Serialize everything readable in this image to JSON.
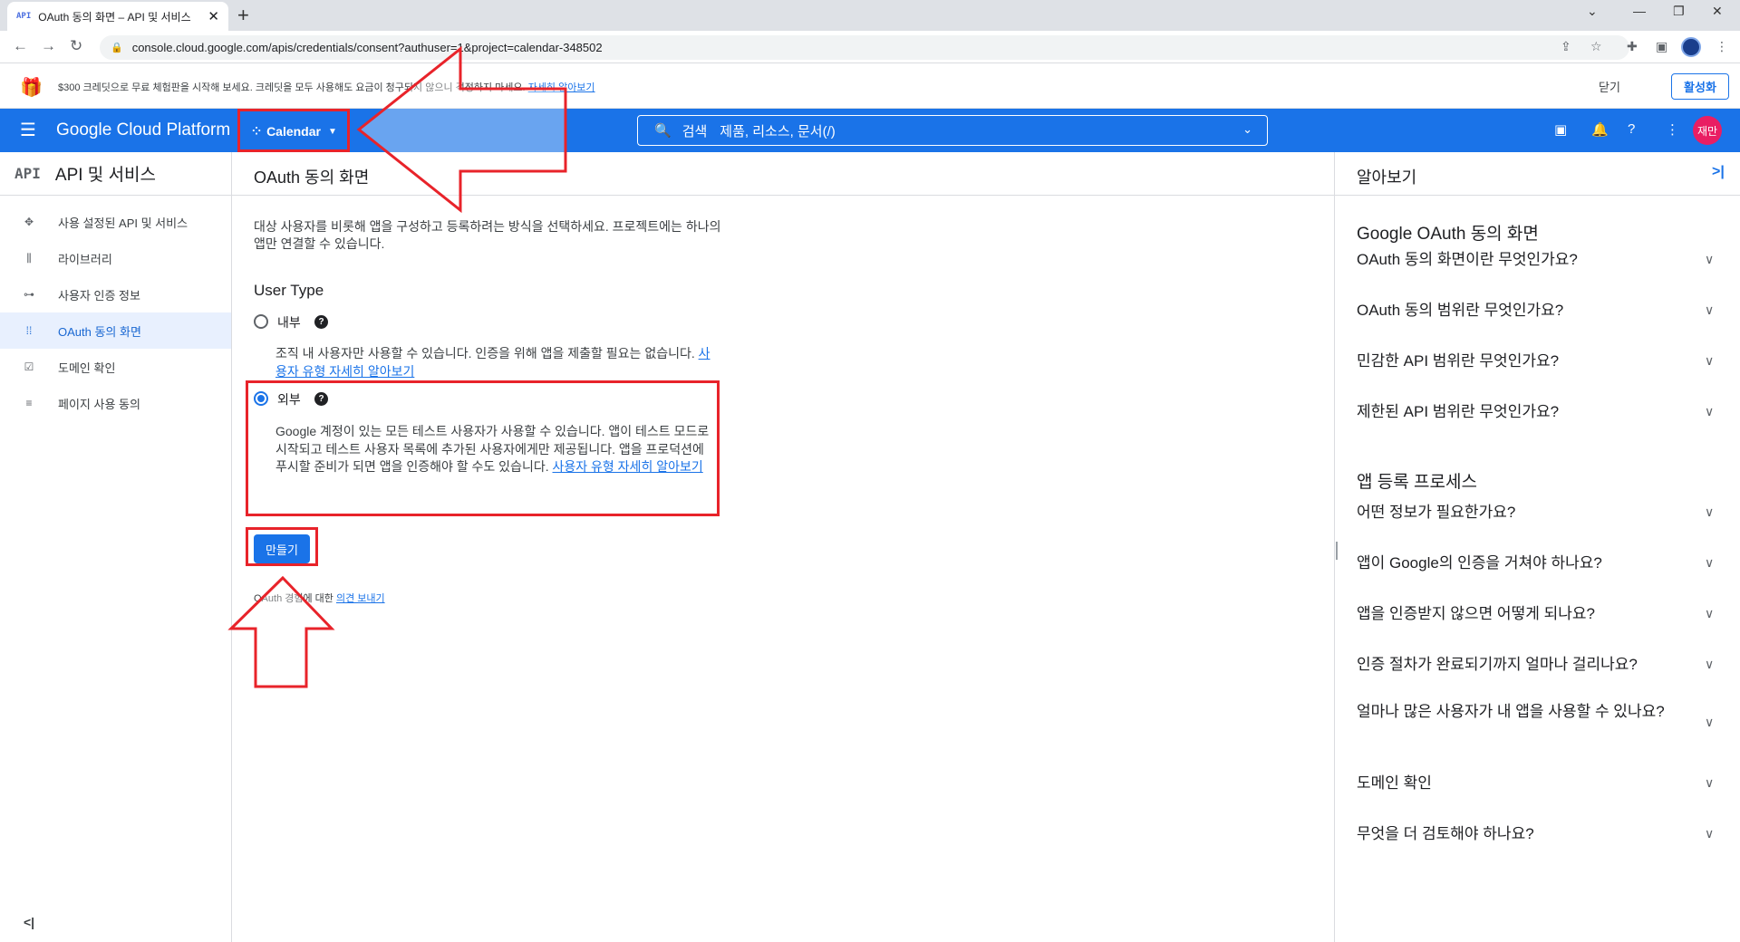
{
  "browser": {
    "tab_favicon": "API",
    "tab_title": "OAuth 동의 화면 – API 및 서비스",
    "tab_close": "✕",
    "new_tab": "+",
    "url": "console.cloud.google.com/apis/credentials/consent?authuser=1&project=calendar-348502"
  },
  "banner": {
    "text": "$300 크레딧으로 무료 체험판을 시작해 보세요. 크레딧을 모두 사용해도 요금이 청구되지 않으니 걱정하지 마세요.",
    "link": "자세히 알아보기",
    "dismiss": "닫기",
    "activate": "활성화"
  },
  "gcp_header": {
    "brand": "Google Cloud Platform",
    "project": "Calendar",
    "search_label": "검색",
    "search_placeholder": "제품, 리소스, 문서(/)",
    "avatar": "재만"
  },
  "sidebar": {
    "logo": "API",
    "title": "API 및 서비스",
    "items": [
      {
        "label": "사용 설정된 API 및 서비스",
        "icon": "diamond-icon"
      },
      {
        "label": "라이브러리",
        "icon": "library-icon"
      },
      {
        "label": "사용자 인증 정보",
        "icon": "key-icon"
      },
      {
        "label": "OAuth 동의 화면",
        "icon": "consent-icon"
      },
      {
        "label": "도메인 확인",
        "icon": "checkbox-icon"
      },
      {
        "label": "페이지 사용 동의",
        "icon": "settings-list-icon"
      }
    ],
    "collapse": "<|"
  },
  "main": {
    "title": "OAuth 동의 화면",
    "intro": "대상 사용자를 비롯해 앱을 구성하고 등록하려는 방식을 선택하세요. 프로젝트에는 하나의 앱만 연결할 수 있습니다.",
    "user_type_heading": "User Type",
    "internal": {
      "label": "내부",
      "desc": "조직 내 사용자만 사용할 수 있습니다. 인증을 위해 앱을 제출할 필요는 없습니다.",
      "link": "사용자 유형 자세히 알아보기"
    },
    "external": {
      "label": "외부",
      "desc": "Google 계정이 있는 모든 테스트 사용자가 사용할 수 있습니다. 앱이 테스트 모드로 시작되고 테스트 사용자 목록에 추가된 사용자에게만 제공됩니다. 앱을 프로덕션에 푸시할 준비가 되면 앱을 인증해야 할 수도 있습니다.",
      "link": "사용자 유형 자세히 알아보기"
    },
    "selected_user_type": "외부",
    "create_button": "만들기",
    "feedback_prefix": "OAuth 경험에 대한",
    "feedback_link": "의견 보내기"
  },
  "help_panel": {
    "title": "알아보기",
    "section1": "Google OAuth 동의 화면",
    "faq1": [
      "OAuth 동의 화면이란 무엇인가요?",
      "OAuth 동의 범위란 무엇인가요?",
      "민감한 API 범위란 무엇인가요?",
      "제한된 API 범위란 무엇인가요?"
    ],
    "section2": "앱 등록 프로세스",
    "faq2": [
      "어떤 정보가 필요한가요?",
      "앱이 Google의 인증을 거쳐야 하나요?",
      "앱을 인증받지 않으면 어떻게 되나요?",
      "인증 절차가 완료되기까지 얼마나 걸리나요?",
      "얼마나 많은 사용자가 내 앱을 사용할 수 있나요?",
      "도메인 확인",
      "무엇을 더 검토해야 하나요?"
    ]
  },
  "colors": {
    "gcp_blue": "#1a73e8",
    "annotation_red": "#e8232a"
  }
}
